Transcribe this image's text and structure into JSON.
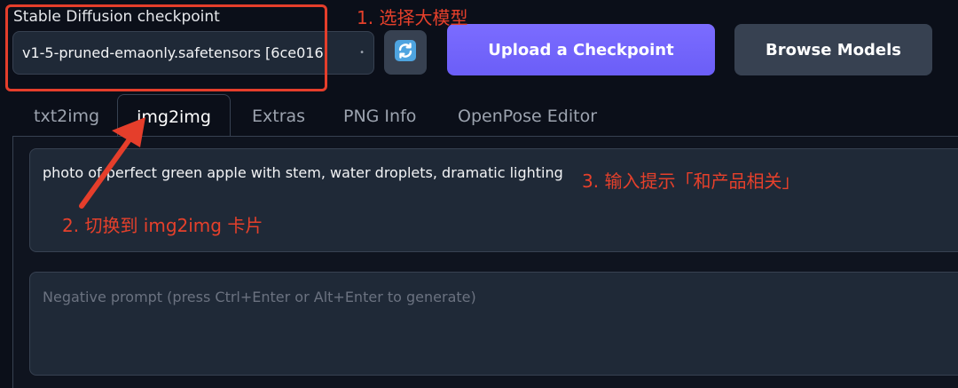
{
  "checkpoint": {
    "label": "Stable Diffusion checkpoint",
    "value": "v1-5-pruned-emaonly.safetensors [6ce016"
  },
  "buttons": {
    "upload": "Upload a Checkpoint",
    "browse": "Browse Models"
  },
  "tabs": [
    "txt2img",
    "img2img",
    "Extras",
    "PNG Info",
    "OpenPose Editor"
  ],
  "active_tab": "img2img",
  "prompt": {
    "value": "photo of perfect green apple with stem, water droplets, dramatic lighting"
  },
  "negative_prompt": {
    "placeholder": "Negative prompt (press Ctrl+Enter or Alt+Enter to generate)"
  },
  "annotations": {
    "step1": "1. 选择大模型",
    "step2": "2. 切换到 img2img 卡片",
    "step3": "3. 输入提示「和产品相关」"
  },
  "colors": {
    "background": "#0b0f19",
    "accent": "#6b5ef7",
    "annotation": "#e5402b"
  }
}
